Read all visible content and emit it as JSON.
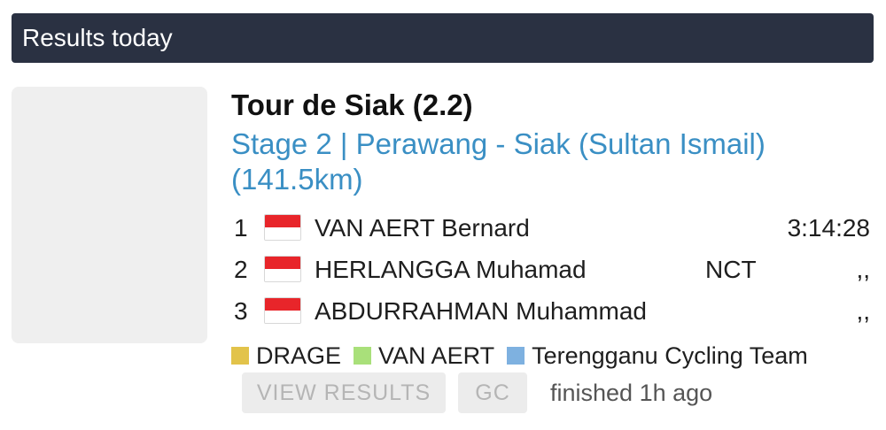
{
  "header": {
    "title": "Results today"
  },
  "race": {
    "title": "Tour de Siak (2.2)",
    "stage": "Stage 2 | Perawang - Siak (Sultan Ismail) (141.5km)"
  },
  "results": [
    {
      "pos": "1",
      "name": "VAN AERT Bernard",
      "team": "",
      "time": "3:14:28",
      "flag": "indonesia-flag-icon"
    },
    {
      "pos": "2",
      "name": "HERLANGGA Muhamad",
      "team": "NCT",
      "time": ",,",
      "flag": "indonesia-flag-icon"
    },
    {
      "pos": "3",
      "name": "ABDURRAHMAN Muhammad",
      "team": "",
      "time": ",,",
      "flag": "indonesia-flag-icon"
    }
  ],
  "legend": [
    {
      "label": "DRAGE",
      "color": "#e2c34a"
    },
    {
      "label": "VAN AERT",
      "color": "#a9e07a"
    },
    {
      "label": "Terengganu Cycling Team",
      "color": "#7eb1e0"
    }
  ],
  "actions": {
    "view_results": "VIEW RESULTS",
    "gc": "GC",
    "status": "finished 1h ago"
  },
  "colors": {
    "header_bg": "#2a3142",
    "link": "#3a8fc4",
    "flag_red": "#e8252a"
  }
}
